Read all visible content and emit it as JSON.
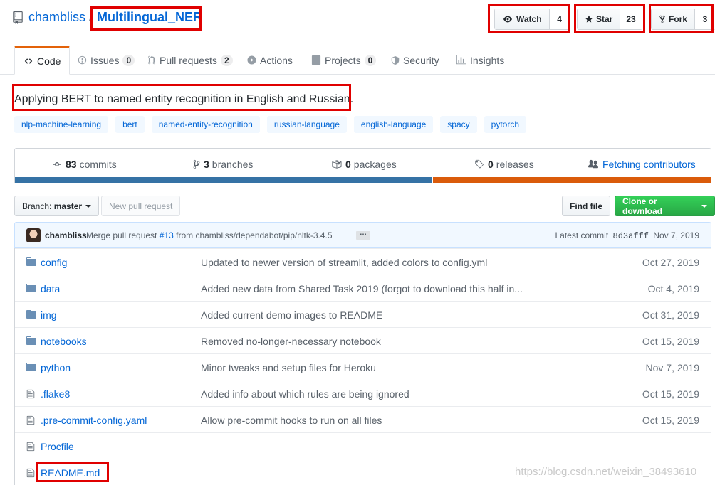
{
  "repo": {
    "owner": "chambliss",
    "separator": "/",
    "name": "Multilingual_NER"
  },
  "actions": {
    "watch": {
      "label": "Watch",
      "count": "4"
    },
    "star": {
      "label": "Star",
      "count": "23"
    },
    "fork": {
      "label": "Fork",
      "count": "3"
    }
  },
  "tabs": [
    {
      "label": "Code"
    },
    {
      "label": "Issues",
      "count": "0"
    },
    {
      "label": "Pull requests",
      "count": "2"
    },
    {
      "label": "Actions"
    },
    {
      "label": "Projects",
      "count": "0"
    },
    {
      "label": "Security"
    },
    {
      "label": "Insights"
    }
  ],
  "description": "Applying BERT to named entity recognition in English and Russian.",
  "topics": [
    "nlp-machine-learning",
    "bert",
    "named-entity-recognition",
    "russian-language",
    "english-language",
    "spacy",
    "pytorch"
  ],
  "summary": {
    "commits": {
      "num": "83",
      "label": "commits"
    },
    "branches": {
      "num": "3",
      "label": "branches"
    },
    "packages": {
      "num": "0",
      "label": "packages"
    },
    "releases": {
      "num": "0",
      "label": "releases"
    },
    "contributors": "Fetching contributors"
  },
  "toolbar": {
    "branch_label": "Branch:",
    "branch_value": "master",
    "new_pr": "New pull request",
    "find_file": "Find file",
    "clone": "Clone or download"
  },
  "latest_commit": {
    "author": "chambliss",
    "msg_prefix": "Merge pull request",
    "pr_link": "#13",
    "msg_suffix": "from chambliss/dependabot/pip/nltk-3.4.5",
    "ellipsis": "…",
    "latest_label": "Latest commit",
    "sha": "8d3afff",
    "date": "Nov 7, 2019"
  },
  "files": [
    {
      "type": "dir",
      "name": "config",
      "message": "Updated to newer version of streamlit, added colors to config.yml",
      "age": "Oct 27, 2019"
    },
    {
      "type": "dir",
      "name": "data",
      "message": "Added new data from Shared Task 2019 (forgot to download this half in...",
      "age": "Oct 4, 2019"
    },
    {
      "type": "dir",
      "name": "img",
      "message": "Added current demo images to README",
      "age": "Oct 31, 2019"
    },
    {
      "type": "dir",
      "name": "notebooks",
      "message": "Removed no-longer-necessary notebook",
      "age": "Oct 15, 2019"
    },
    {
      "type": "dir",
      "name": "python",
      "message": "Minor tweaks and setup files for Heroku",
      "age": "Nov 7, 2019"
    },
    {
      "type": "file",
      "name": ".flake8",
      "message": "Added info about which rules are being ignored",
      "age": "Oct 15, 2019"
    },
    {
      "type": "file",
      "name": ".pre-commit-config.yaml",
      "message": "Allow pre-commit hooks to run on all files",
      "age": "Oct 15, 2019"
    },
    {
      "type": "file",
      "name": "Procfile",
      "message": "",
      "age": ""
    },
    {
      "type": "file",
      "name": "README.md",
      "message": "",
      "age": ""
    }
  ],
  "watermark": "https://blog.csdn.net/weixin_38493610",
  "colors": {
    "python": "#3572A5",
    "jupyter": "#DA5B0B",
    "accent": "#e36209",
    "highlight": "#e00000"
  }
}
